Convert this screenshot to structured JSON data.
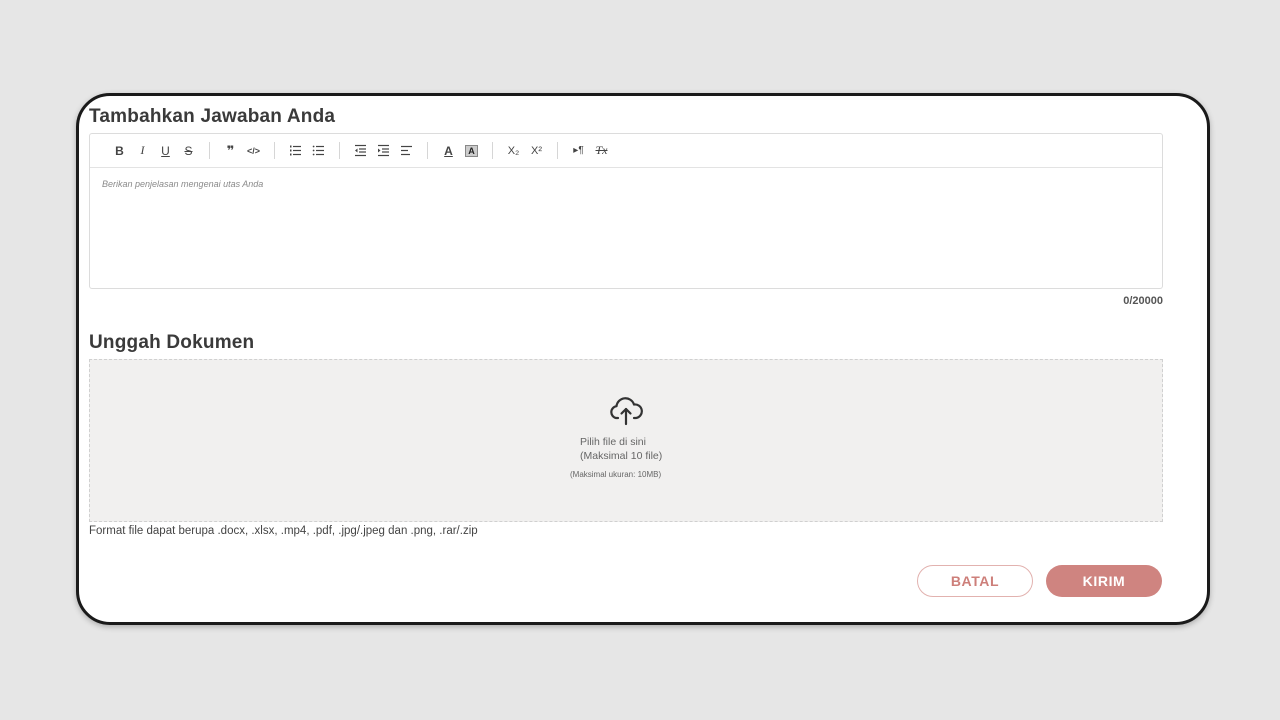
{
  "answer_section": {
    "title": "Tambahkan Jawaban Anda",
    "editor": {
      "placeholder": "Berikan penjelasan mengenai utas Anda",
      "toolbar": [
        {
          "group": "text-style",
          "items": [
            {
              "name": "bold-icon",
              "label": "B"
            },
            {
              "name": "italic-icon",
              "label": "I"
            },
            {
              "name": "underline-icon",
              "label": "U"
            },
            {
              "name": "strikethrough-icon",
              "label": "S"
            }
          ]
        },
        {
          "group": "blocks",
          "items": [
            {
              "name": "quote-icon",
              "label": "❞"
            },
            {
              "name": "code-icon",
              "label": "</>"
            }
          ]
        },
        {
          "group": "lists",
          "items": [
            {
              "name": "ordered-list-icon"
            },
            {
              "name": "bullet-list-icon"
            }
          ]
        },
        {
          "group": "indent",
          "items": [
            {
              "name": "outdent-icon"
            },
            {
              "name": "indent-icon"
            },
            {
              "name": "align-left-icon"
            }
          ]
        },
        {
          "group": "color",
          "items": [
            {
              "name": "font-color-icon",
              "label": "A"
            },
            {
              "name": "background-color-icon",
              "label": "A"
            }
          ]
        },
        {
          "group": "script",
          "items": [
            {
              "name": "subscript-icon",
              "label": "X₂"
            },
            {
              "name": "superscript-icon",
              "label": "X²"
            }
          ]
        },
        {
          "group": "misc",
          "items": [
            {
              "name": "text-direction-icon",
              "label": "▸¶"
            },
            {
              "name": "clear-format-icon",
              "label": "Tx"
            }
          ]
        }
      ]
    },
    "counter": "0/20000"
  },
  "upload_section": {
    "title": "Unggah Dokumen",
    "dropzone": {
      "icon": "cloud-upload-icon",
      "line1": "Pilih file di sini",
      "line2": "(Maksimal 10 file)",
      "line3": "(Maksimal ukuran: 10MB)"
    },
    "format_note": "Format file dapat berupa .docx, .xlsx, .mp4, .pdf, .jpg/.jpeg dan .png, .rar/.zip"
  },
  "actions": {
    "cancel_label": "BATAL",
    "submit_label": "KIRIM"
  },
  "colors": {
    "accent": "#cf8480",
    "cancel_text": "#cd7f7a",
    "dropzone_bg": "#f1f0ef",
    "page_bg": "#e6e6e6"
  }
}
